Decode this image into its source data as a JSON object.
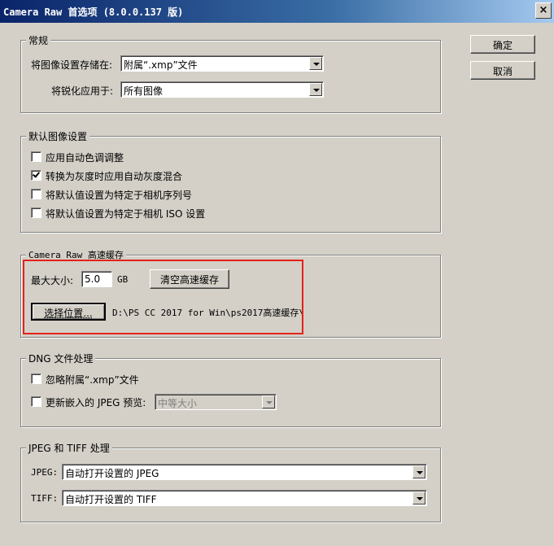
{
  "window": {
    "title": "Camera Raw 首选项  (8.0.0.137 版)",
    "close_label": "×"
  },
  "buttons": {
    "ok": "确定",
    "cancel": "取消"
  },
  "general": {
    "legend": "常规",
    "save_settings_label": "将图像设置存储在:",
    "save_settings_value": "附属“.xmp”文件",
    "sharpen_label": "将锐化应用于:",
    "sharpen_value": "所有图像"
  },
  "defaults": {
    "legend": "默认图像设置",
    "items": [
      {
        "label": "应用自动色调调整",
        "checked": false
      },
      {
        "label": "转换为灰度时应用自动灰度混合",
        "checked": true
      },
      {
        "label": "将默认值设置为特定于相机序列号",
        "checked": false
      },
      {
        "label": "将默认值设置为特定于相机 ISO 设置",
        "checked": false
      }
    ]
  },
  "cache": {
    "legend": "Camera Raw 高速缓存",
    "max_size_label": "最大大小:",
    "max_size_value": "5.0",
    "unit": "GB",
    "purge_button": "清空高速缓存",
    "select_location_button": "选择位置...",
    "path": "D:\\PS CC 2017 for Win\\ps2017高速缓存\\",
    "highlight_color": "#e2231a"
  },
  "dng": {
    "legend": "DNG 文件处理",
    "ignore_sidecar_label": "忽略附属“.xmp”文件",
    "ignore_sidecar_checked": false,
    "update_jpeg_label": "更新嵌入的 JPEG 预览:",
    "update_jpeg_checked": false,
    "preview_size_value": "中等大小"
  },
  "jpeg_tiff": {
    "legend": "JPEG 和 TIFF 处理",
    "jpeg_label": "JPEG:",
    "jpeg_value": "自动打开设置的 JPEG",
    "tiff_label": "TIFF:",
    "tiff_value": "自动打开设置的 TIFF"
  }
}
